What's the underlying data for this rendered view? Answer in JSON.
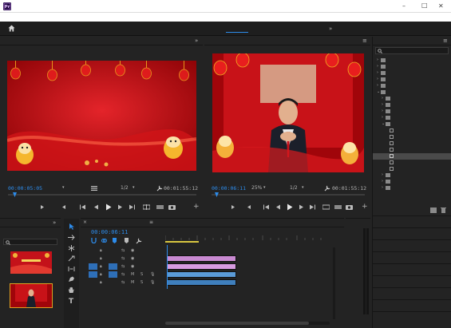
{
  "colors": {
    "accent_blue": "#2d8ceb",
    "panel_bg": "#232323",
    "header_bg": "#1e1e1e",
    "clip_pink": "#d79be0",
    "clip_audio": "#5a9ad6"
  },
  "titlebar": {
    "title": "",
    "controls": {
      "minimize": "–",
      "maximize": "□",
      "close": "✕"
    }
  },
  "menubar": {
    "items": [
      "",
      "",
      "",
      "",
      "",
      "",
      "",
      "",
      ""
    ]
  },
  "workspaces": {
    "tabs": [
      {
        "label": "",
        "active": false
      },
      {
        "label": "",
        "active": false
      },
      {
        "label": "",
        "active": false
      },
      {
        "label": "",
        "active": false
      },
      {
        "label": "",
        "active": true
      },
      {
        "label": "",
        "active": false
      },
      {
        "label": "",
        "active": false
      },
      {
        "label": "",
        "active": false
      }
    ],
    "overflow": "»"
  },
  "source_monitor": {
    "tabs": [
      {
        "label": "",
        "active": true
      },
      {
        "label": "",
        "active": false
      }
    ],
    "overflow": "»",
    "video_text_line1": "",
    "video_text_line2": "",
    "video_number": "",
    "timecode_in": "00:00:05:05",
    "fit": "",
    "resolution": "1/2",
    "duration": "00:01:55:12"
  },
  "program_monitor": {
    "tab_label": "",
    "menu_icon": "≡",
    "video_badge": "",
    "timecode": "00:00:06:11",
    "zoom": "25%",
    "resolution": "1/2",
    "duration": "00:01:55:12"
  },
  "effects_panel": {
    "tab_label": "",
    "menu_icon": "≡",
    "search_value": "",
    "tree": [
      {
        "label": "",
        "indent": 0,
        "kind": "folder",
        "selected": false
      },
      {
        "label": "",
        "indent": 0,
        "kind": "folder",
        "selected": false
      },
      {
        "label": "",
        "indent": 0,
        "kind": "folder",
        "selected": false
      },
      {
        "label": "",
        "indent": 0,
        "kind": "folder",
        "selected": false
      },
      {
        "label": "",
        "indent": 0,
        "kind": "folder",
        "selected": false
      },
      {
        "label": "",
        "indent": 0,
        "kind": "folder",
        "selected": false
      },
      {
        "label": "",
        "indent": 1,
        "kind": "folder",
        "selected": false
      },
      {
        "label": "",
        "indent": 1,
        "kind": "folder",
        "selected": false
      },
      {
        "label": "",
        "indent": 1,
        "kind": "folder",
        "selected": false
      },
      {
        "label": "",
        "indent": 1,
        "kind": "folder",
        "selected": false
      },
      {
        "label": "",
        "indent": 1,
        "kind": "folder",
        "selected": false
      },
      {
        "label": "",
        "indent": 2,
        "kind": "effect",
        "selected": false
      },
      {
        "label": "",
        "indent": 2,
        "kind": "effect",
        "selected": false
      },
      {
        "label": "",
        "indent": 2,
        "kind": "effect",
        "selected": false
      },
      {
        "label": "",
        "indent": 2,
        "kind": "effect",
        "selected": false
      },
      {
        "label": "",
        "indent": 2,
        "kind": "effect",
        "selected": true
      },
      {
        "label": "",
        "indent": 2,
        "kind": "effect",
        "selected": false
      },
      {
        "label": "",
        "indent": 2,
        "kind": "effect",
        "selected": false
      },
      {
        "label": "",
        "indent": 1,
        "kind": "folder",
        "selected": false
      },
      {
        "label": "",
        "indent": 1,
        "kind": "folder",
        "selected": false
      },
      {
        "label": "",
        "indent": 1,
        "kind": "folder",
        "selected": false
      }
    ],
    "side_panels": [
      "",
      "",
      "",
      "",
      "",
      "",
      "",
      "",
      ""
    ]
  },
  "project_panel": {
    "tab_label": "",
    "overflow": "»",
    "project_name": "",
    "item1_name": "",
    "item1_duration": "",
    "item2_name": "",
    "item2_duration": "",
    "item2_badge": ""
  },
  "timeline": {
    "tab_label": "",
    "timecode": "00:00:06:11",
    "ruler": [
      "",
      "",
      "",
      "",
      ""
    ],
    "tracks": [
      {
        "name": "",
        "label": ""
      },
      {
        "name": "",
        "label": ""
      },
      {
        "name": "",
        "label": ""
      },
      {
        "name": "",
        "label": ""
      },
      {
        "name": "",
        "label": ""
      }
    ],
    "clip_image": "",
    "clip_video": "",
    "clip_audio": "",
    "meter_labels": [
      "",
      "",
      "",
      "",
      "",
      "",
      ""
    ],
    "meter_bottom": ""
  }
}
